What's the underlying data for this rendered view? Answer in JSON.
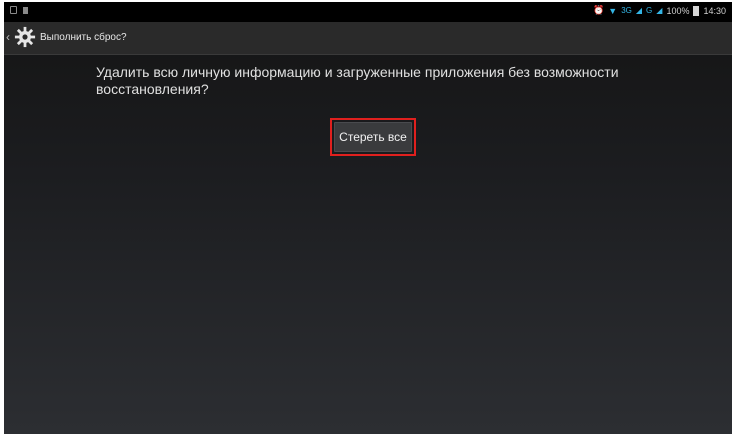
{
  "status_bar": {
    "network": "3G",
    "network2": "G",
    "battery": "100%",
    "time": "14:30"
  },
  "action_bar": {
    "title": "Выполнить сброс?"
  },
  "dialog": {
    "message": "Удалить всю личную информацию и загруженные приложения без возможности восстановления?",
    "erase_button_label": "Стереть все"
  },
  "colors": {
    "highlight": "#e0201e",
    "status_accent": "#34b5e5"
  }
}
